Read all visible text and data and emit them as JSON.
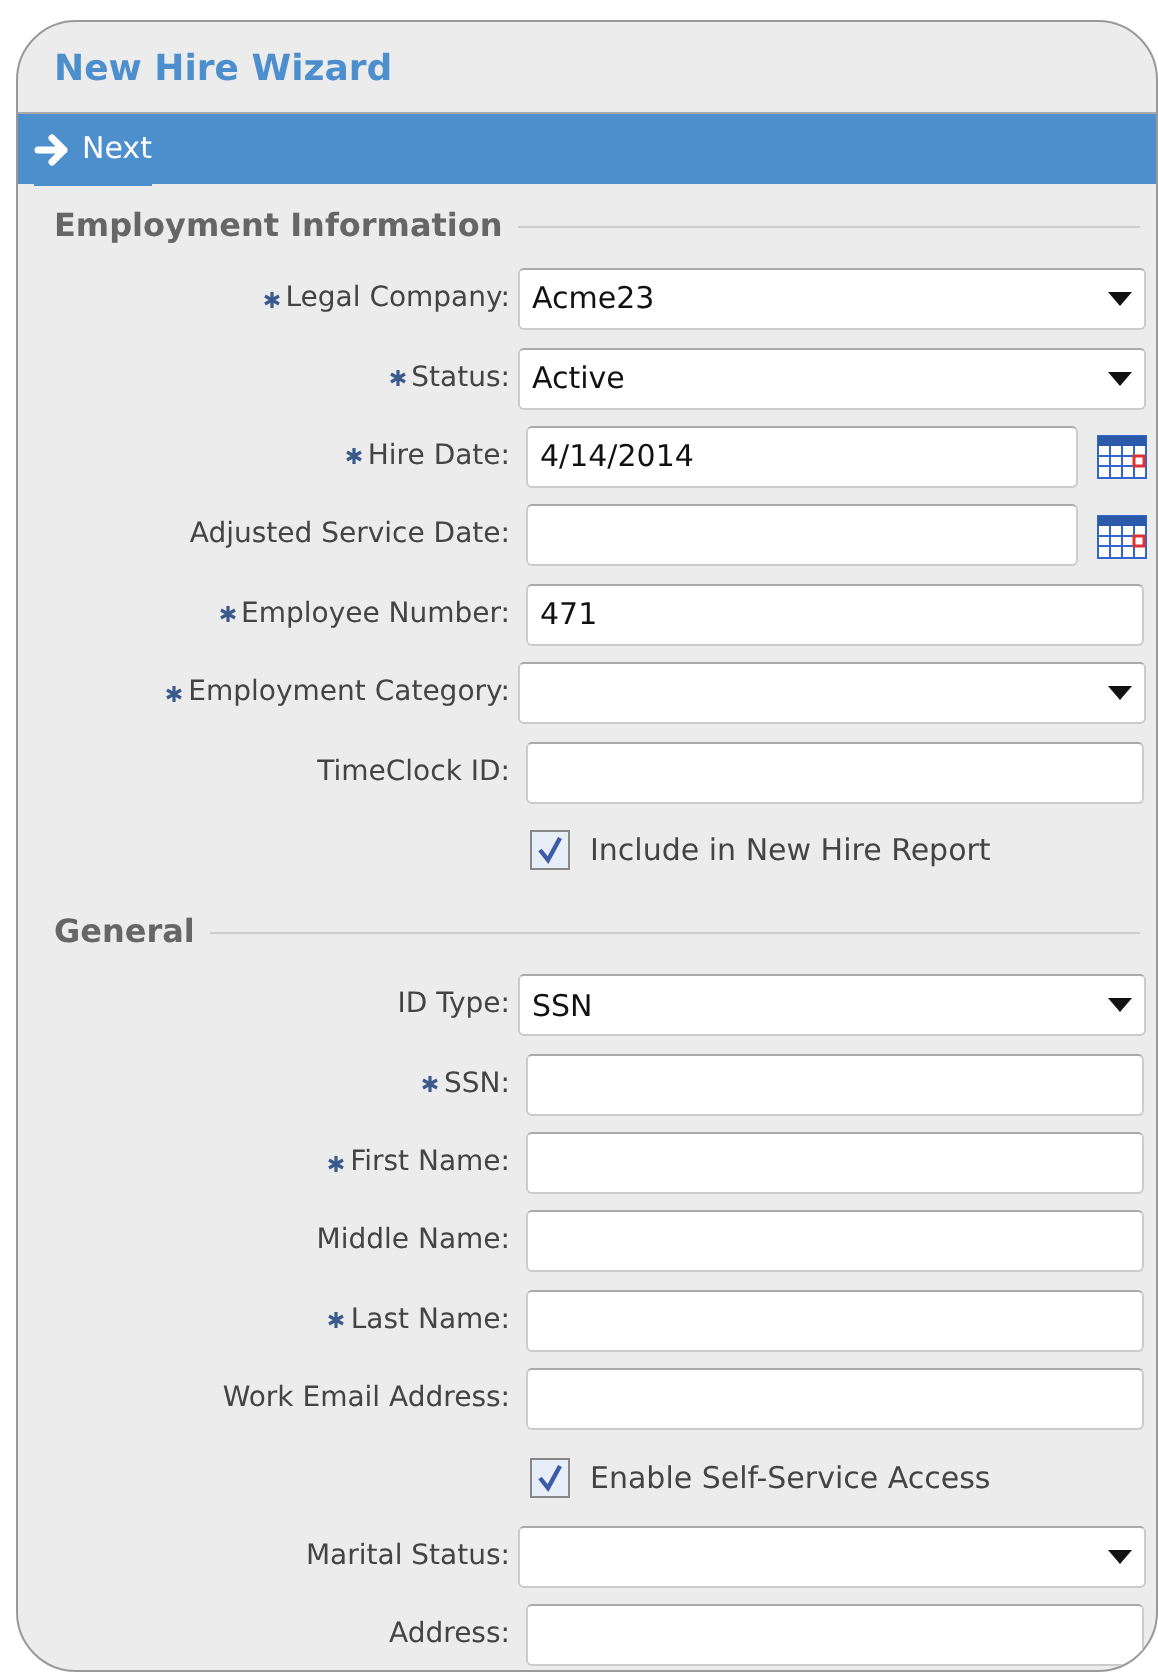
{
  "window": {
    "title": "New Hire Wizard"
  },
  "toolbar": {
    "next_button": "Next"
  },
  "sections": [
    {
      "title": "Employment Information",
      "fields": [
        {
          "kind": "select",
          "label": "Legal Company:",
          "required": true,
          "value": "Acme23"
        },
        {
          "kind": "select",
          "label": "Status:",
          "required": true,
          "value": "Active"
        },
        {
          "kind": "date",
          "label": "Hire Date:",
          "required": true,
          "value": "4/14/2014"
        },
        {
          "kind": "date",
          "label": "Adjusted Service Date:",
          "required": false
        },
        {
          "kind": "text",
          "label": "Employee Number:",
          "required": true,
          "value": "471"
        },
        {
          "kind": "select",
          "label": "Employment Category:",
          "required": true
        },
        {
          "kind": "text",
          "label": "TimeClock ID:",
          "required": false
        },
        {
          "kind": "checkbox",
          "label": "Include in New Hire Report",
          "checked": true
        }
      ]
    },
    {
      "title": "General",
      "fields": [
        {
          "kind": "select",
          "label": "ID Type:",
          "required": false,
          "value": "SSN"
        },
        {
          "kind": "text",
          "label": "SSN:",
          "required": true
        },
        {
          "kind": "text",
          "label": "First Name:",
          "required": true
        },
        {
          "kind": "text",
          "label": "Middle Name:",
          "required": false
        },
        {
          "kind": "text",
          "label": "Last Name:",
          "required": true
        },
        {
          "kind": "text",
          "label": "Work Email Address:",
          "required": false
        },
        {
          "kind": "checkbox",
          "label": "Enable Self-Service Access",
          "checked": true
        },
        {
          "kind": "select",
          "label": "Marital Status:",
          "required": false
        },
        {
          "kind": "text",
          "label": "Address:",
          "required": false
        }
      ]
    }
  ]
}
